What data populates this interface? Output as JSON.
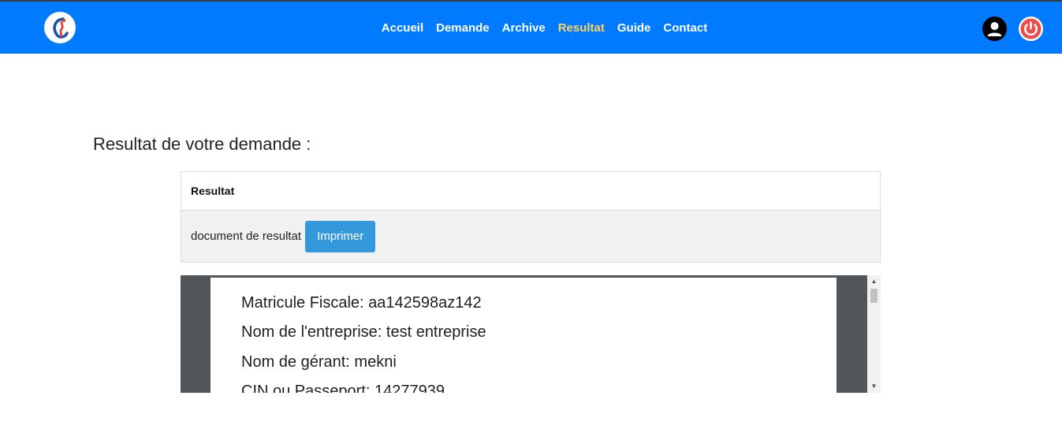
{
  "navbar": {
    "links": [
      "Accueil",
      "Demande",
      "Archive",
      "Resultat",
      "Guide",
      "Contact"
    ],
    "active_link": "Resultat",
    "colors": {
      "background": "#007bff",
      "link": "#ffffff",
      "active": "#ffd35b"
    },
    "icons": [
      "logo-icon",
      "user-icon",
      "power-icon"
    ]
  },
  "main": {
    "title": "Resultat de votre demande :",
    "card": {
      "header": "Resultat",
      "body_text": "document de resultat",
      "print_label": "Imprimer"
    },
    "document": {
      "lines": [
        "Matricule Fiscale: aa142598az142",
        "Nom de l'entreprise: test entreprise",
        "Nom de gérant: mekni",
        "CIN ou Passeport: 14277939"
      ]
    }
  },
  "colors": {
    "button": "#3498db",
    "viewer_background": "#525659"
  }
}
